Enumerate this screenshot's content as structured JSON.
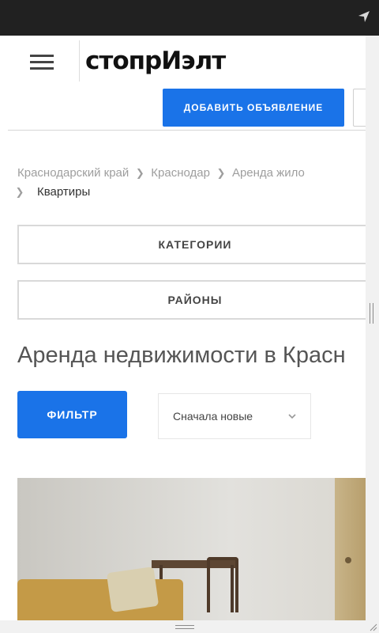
{
  "status_bar": {
    "icon": "navigation-arrow-icon"
  },
  "header": {
    "menu_icon": "hamburger-menu-icon",
    "logo_text": "стопрИэлт",
    "add_button_label": "Добавить объявление"
  },
  "breadcrumb": {
    "items": [
      "Краснодарский край",
      "Краснодар",
      "Аренда жило"
    ],
    "separator": "❯",
    "current": "Квартиры"
  },
  "filters": {
    "categories_label": "КАТЕГОРИИ",
    "districts_label": "РАЙОНЫ"
  },
  "main": {
    "title": "Аренда недвижимости в Красн",
    "filter_button_label": "ФИЛЬТР",
    "sort": {
      "selected": "Сначала новые",
      "chevron_icon": "chevron-down-icon"
    }
  },
  "listing": {
    "photo": "room-photo"
  },
  "colors": {
    "accent": "#1a73e8",
    "status_bar": "#212121",
    "text_muted": "#9e9e9e"
  }
}
